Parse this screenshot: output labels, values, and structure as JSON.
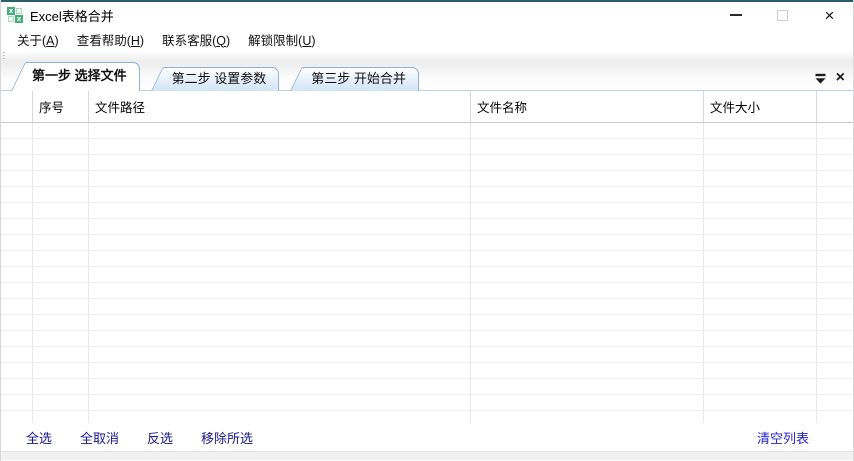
{
  "window": {
    "title": "Excel表格合并",
    "close_glyph": "×"
  },
  "menu": {
    "items": [
      {
        "name": "about",
        "prefix": "关于(",
        "key": "A",
        "suffix": ")"
      },
      {
        "name": "view-help",
        "prefix": "查看帮助(",
        "key": "H",
        "suffix": ")"
      },
      {
        "name": "contact-support",
        "prefix": "联系客服(",
        "key": "Q",
        "suffix": ")"
      },
      {
        "name": "unlock-limit",
        "prefix": "解锁限制(",
        "key": "U",
        "suffix": ")"
      }
    ]
  },
  "tabs": {
    "close_glyph": "×",
    "items": [
      {
        "name": "step1-select-files",
        "label": "第一步 选择文件",
        "active": true
      },
      {
        "name": "step2-set-parameters",
        "label": "第二步 设置参数",
        "active": false
      },
      {
        "name": "step3-start-merge",
        "label": "第三步 开始合并",
        "active": false
      }
    ]
  },
  "table": {
    "columns": [
      {
        "name": "checkbox",
        "label": ""
      },
      {
        "name": "index",
        "label": "序号"
      },
      {
        "name": "file-path",
        "label": "文件路径"
      },
      {
        "name": "file-name",
        "label": "文件名称"
      },
      {
        "name": "file-size",
        "label": "文件大小"
      },
      {
        "name": "filler",
        "label": ""
      }
    ],
    "rows": []
  },
  "footer": {
    "links": [
      {
        "name": "select-all",
        "label": "全选"
      },
      {
        "name": "deselect-all",
        "label": "全取消"
      },
      {
        "name": "invert-selection",
        "label": "反选"
      },
      {
        "name": "remove-selected",
        "label": "移除所选"
      }
    ],
    "clear_list_label": "清空列表"
  },
  "colors": {
    "top_accent": "#2b5e6c",
    "tab_border": "#8fb0d4",
    "icon_green": "#41b078",
    "footer_link_navy": "#17178c",
    "clear_link_blue": "#2424cc"
  }
}
